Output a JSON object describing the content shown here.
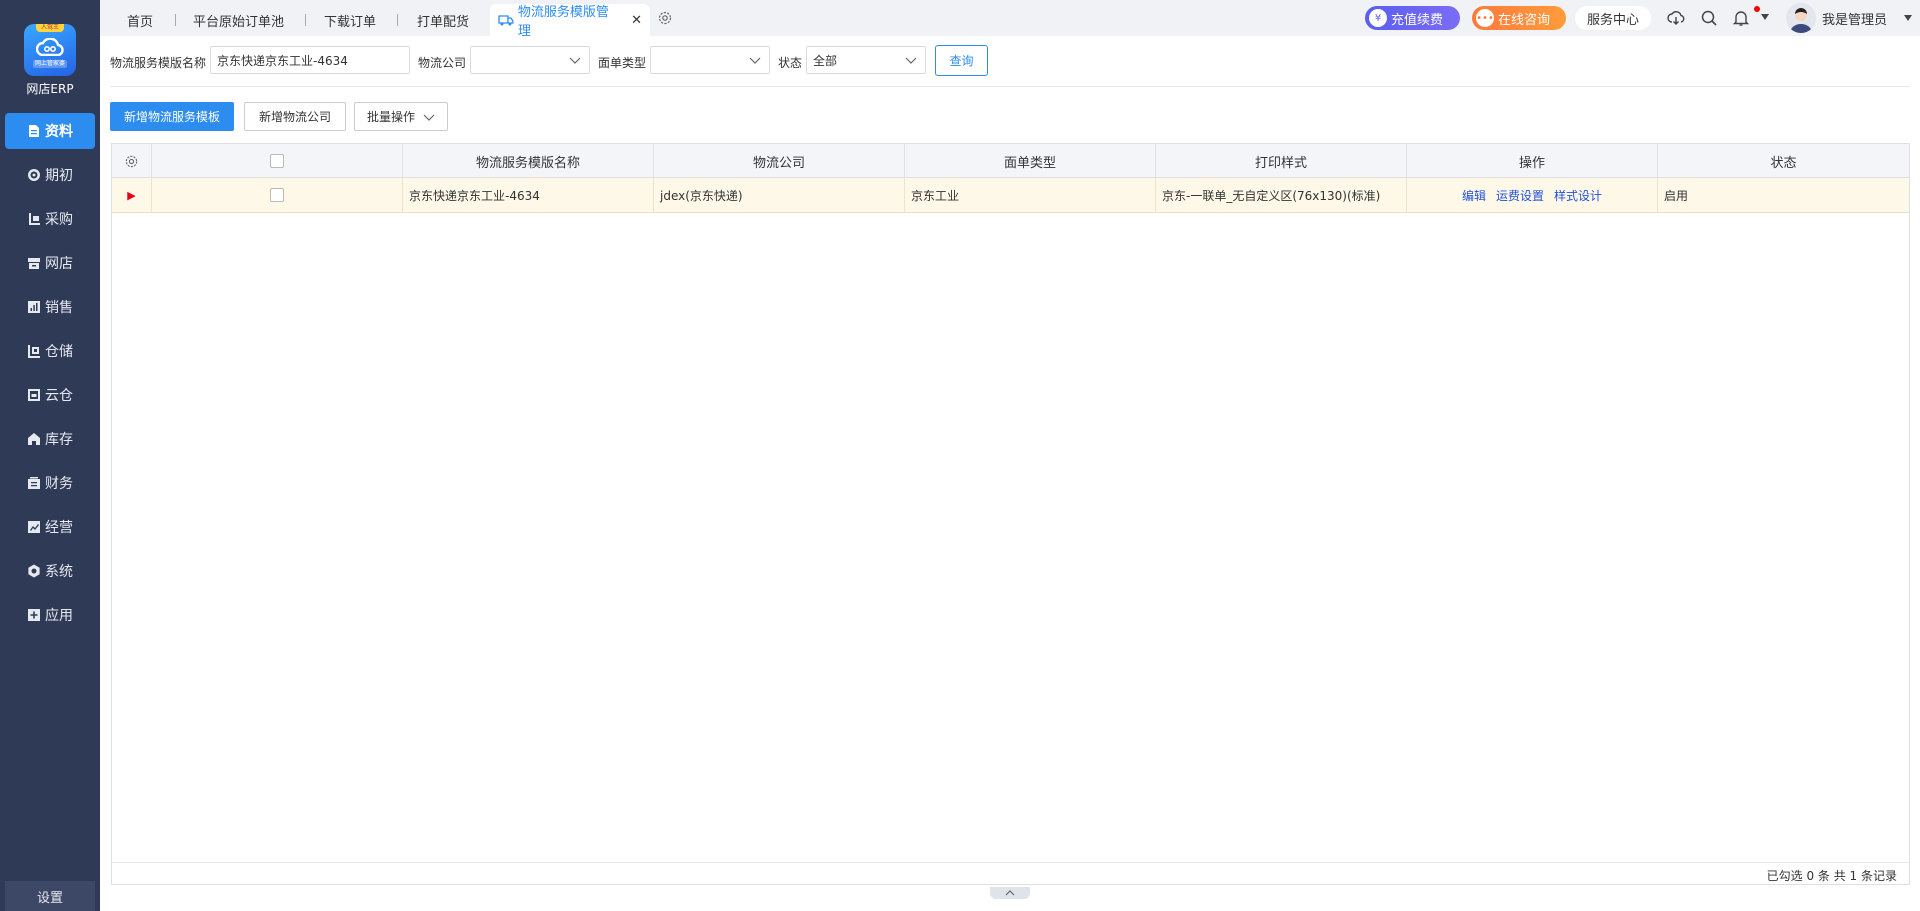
{
  "app": {
    "logo_badge": "人驾王",
    "logo_tag": "网上管家婆",
    "logo_title": "网店ERP"
  },
  "sidebar": {
    "items": [
      {
        "label": "资料",
        "icon": "document-icon",
        "active": true
      },
      {
        "label": "期初",
        "icon": "target-icon"
      },
      {
        "label": "采购",
        "icon": "purchase-icon"
      },
      {
        "label": "网店",
        "icon": "store-icon"
      },
      {
        "label": "销售",
        "icon": "chart-icon"
      },
      {
        "label": "仓储",
        "icon": "warehouse-icon"
      },
      {
        "label": "云仓",
        "icon": "cloud-warehouse-icon"
      },
      {
        "label": "库存",
        "icon": "home-icon"
      },
      {
        "label": "财务",
        "icon": "finance-icon"
      },
      {
        "label": "经营",
        "icon": "trend-icon"
      },
      {
        "label": "系统",
        "icon": "settings-icon"
      },
      {
        "label": "应用",
        "icon": "plus-square-icon"
      }
    ],
    "settings_label": "设置"
  },
  "tabs": {
    "home": "首页",
    "order_pool": "平台原始订单池",
    "download_orders": "下载订单",
    "print_ship": "打单配货",
    "active": "物流服务模版管理",
    "close": "✕"
  },
  "header": {
    "recharge": "充值续费",
    "consult": "在线咨询",
    "service_center": "服务中心",
    "user_name": "我是管理员"
  },
  "filter": {
    "template_name_label": "物流服务模版名称",
    "template_name_value": "京东快递京东工业-4634",
    "company_label": "物流公司",
    "company_value": "",
    "waybill_type_label": "面单类型",
    "waybill_type_value": "",
    "status_label": "状态",
    "status_value": "全部",
    "query_button": "查询"
  },
  "actions": {
    "add_template": "新增物流服务模板",
    "add_company": "新增物流公司",
    "batch": "批量操作"
  },
  "table": {
    "columns": [
      "物流服务模版名称",
      "物流公司",
      "面单类型",
      "打印样式",
      "操作",
      "状态"
    ],
    "rows": [
      {
        "template_name": "京东快递京东工业-4634",
        "company": "jdex(京东快递)",
        "waybill_type": "京东工业",
        "print_style": "京东-一联单_无自定义区(76x130)(标准)",
        "ops": [
          "编辑",
          "运费设置",
          "样式设计"
        ],
        "status": "启用"
      }
    ],
    "footer": "已勾选 0 条  共 1 条记录"
  },
  "colors": {
    "primary": "#2d8cf0",
    "sidebar": "#2f3a57",
    "row_highlight": "#fdf8e8",
    "marker": "#e60012"
  }
}
